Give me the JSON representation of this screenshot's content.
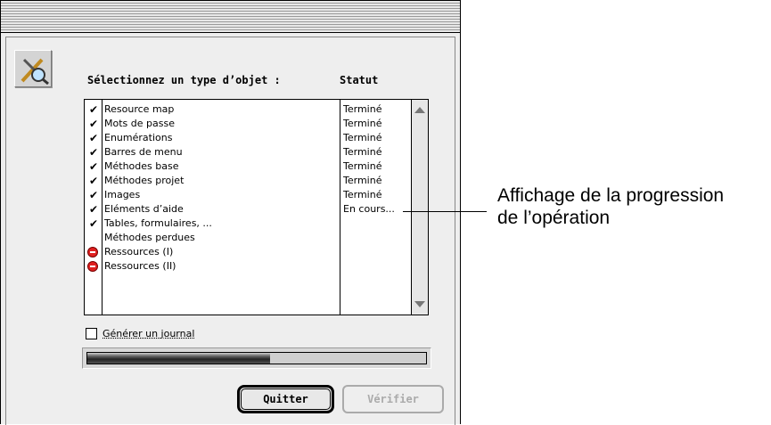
{
  "dialog": {
    "column_type_header": "Sélectionnez un type d’objet :",
    "column_status_header": "Statut",
    "items": [
      {
        "mark": "check",
        "name": "Resource map",
        "status": "Terminé"
      },
      {
        "mark": "check",
        "name": "Mots de passe",
        "status": "Terminé"
      },
      {
        "mark": "check",
        "name": "Enumérations",
        "status": "Terminé"
      },
      {
        "mark": "check",
        "name": "Barres de menu",
        "status": "Terminé"
      },
      {
        "mark": "check",
        "name": "Méthodes base",
        "status": "Terminé"
      },
      {
        "mark": "check",
        "name": "Méthodes projet",
        "status": "Terminé"
      },
      {
        "mark": "check",
        "name": "Images",
        "status": "Terminé"
      },
      {
        "mark": "check",
        "name": "Eléments d’aide",
        "status": "En cours..."
      },
      {
        "mark": "check",
        "name": "Tables, formulaires, ...",
        "status": ""
      },
      {
        "mark": "none",
        "name": "Méthodes perdues",
        "status": ""
      },
      {
        "mark": "stop",
        "name": "Ressources (I)",
        "status": ""
      },
      {
        "mark": "stop",
        "name": "Ressources (II)",
        "status": ""
      }
    ],
    "log_checkbox_label": "Générer un journal",
    "log_checkbox_checked": false,
    "progress_fraction": 0.54,
    "quit_button": "Quitter",
    "verify_button": "Vérifier",
    "verify_enabled": false,
    "icons": {
      "tool": "wrench-magnifier-icon",
      "check": "checkmark-icon",
      "stop": "stop-sign-icon"
    }
  },
  "callout": {
    "line1": "Affichage de la progression",
    "line2": "de l’opération"
  }
}
